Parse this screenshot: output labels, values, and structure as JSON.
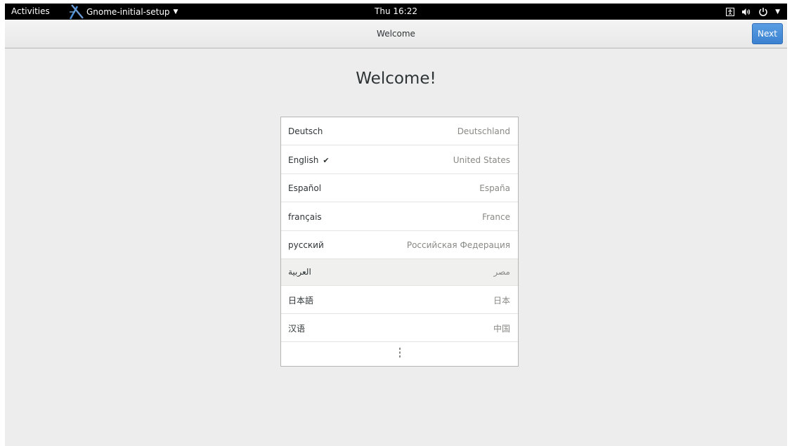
{
  "topbar": {
    "activities": "Activities",
    "app_name": "Gnome-initial-setup",
    "app_arrow": "▼",
    "clock": "Thu 16:22",
    "status_arrow": "▼"
  },
  "window": {
    "title": "Welcome",
    "next_label": "Next",
    "accent_color": "#3b82d0"
  },
  "heading": "Welcome!",
  "languages": [
    {
      "name": "Deutsch",
      "country": "Deutschland",
      "selected": false
    },
    {
      "name": "English",
      "country": "United States",
      "selected": true,
      "check": "✔"
    },
    {
      "name": "Español",
      "country": "España",
      "selected": false
    },
    {
      "name": "français",
      "country": "France",
      "selected": false
    },
    {
      "name": "русский",
      "country": "Российская Федерация",
      "selected": false
    },
    {
      "name": "العربية",
      "country": "مصر",
      "selected": false
    },
    {
      "name": "日本語",
      "country": "日本",
      "selected": false
    },
    {
      "name": "汉语",
      "country": "中国",
      "selected": false
    }
  ],
  "icons": {
    "more": "more-vertical-icon",
    "accessibility": "accessibility-icon",
    "volume": "volume-icon",
    "power": "power-icon"
  }
}
